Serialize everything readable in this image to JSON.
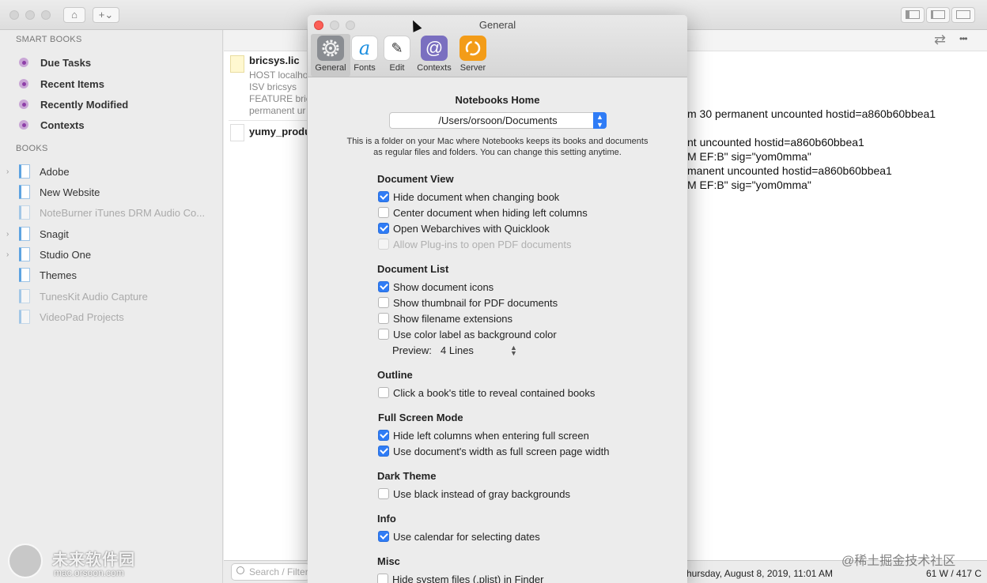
{
  "window": {
    "home_button": "⌂",
    "add_button": "+⌄"
  },
  "sidebar": {
    "smart_title": "SMART BOOKS",
    "smart_items": [
      {
        "label": "Due Tasks"
      },
      {
        "label": "Recent Items"
      },
      {
        "label": "Recently Modified"
      },
      {
        "label": "Contexts"
      }
    ],
    "books_title": "BOOKS",
    "books": [
      {
        "label": "Adobe",
        "disclosure": "›",
        "dim": false
      },
      {
        "label": "New Website",
        "disclosure": "",
        "dim": false
      },
      {
        "label": "NoteBurner iTunes DRM Audio Co...",
        "disclosure": "",
        "dim": true
      },
      {
        "label": "Snagit",
        "disclosure": "›",
        "dim": false
      },
      {
        "label": "Studio One",
        "disclosure": "›",
        "dim": false
      },
      {
        "label": "Themes",
        "disclosure": "",
        "dim": false
      },
      {
        "label": "TunesKit Audio Capture",
        "disclosure": "",
        "dim": true
      },
      {
        "label": "VideoPad Projects",
        "disclosure": "",
        "dim": true
      }
    ]
  },
  "doclist": {
    "docs": [
      {
        "title": "bricsys.lic",
        "preview": [
          "HOST localho",
          "ISV bricsys",
          "FEATURE bric",
          "permanent ur"
        ]
      },
      {
        "title": "yumy_produ",
        "preview": []
      }
    ],
    "search_placeholder": "Search / Filter"
  },
  "content": {
    "lines": [
      "m 30 permanent uncounted hostid=a860b60bbea1",
      "nt uncounted hostid=a860b60bbea1",
      "M EF:B\" sig=\"yom0mma\"",
      "manent uncounted hostid=a860b60bbea1",
      "M EF:B\" sig=\"yom0mma\""
    ],
    "swap_icon": "⇄",
    "more_icon": "•••"
  },
  "status": {
    "date": "hursday, August 8, 2019, 11:01 AM",
    "counts": "61 W / 417 C"
  },
  "prefs": {
    "title": "General",
    "tabs": [
      {
        "label": "General",
        "icon": "gear-icon"
      },
      {
        "label": "Fonts",
        "icon": "fonts-icon",
        "glyph": "a"
      },
      {
        "label": "Edit",
        "icon": "pencil-icon",
        "glyph": "✎"
      },
      {
        "label": "Contexts",
        "icon": "at-icon",
        "glyph": "@"
      },
      {
        "label": "Server",
        "icon": "sync-icon"
      }
    ],
    "home_heading": "Notebooks Home",
    "home_path": "/Users/orsoon/Documents",
    "help_line1": "This is a folder on your Mac where Notebooks keeps its books and documents",
    "help_line2": "as regular files and folders. You can change this setting anytime.",
    "groups": {
      "document_view": {
        "title": "Document View",
        "options": [
          {
            "label": "Hide document when changing book",
            "checked": true
          },
          {
            "label": "Center document when hiding left columns",
            "checked": false
          },
          {
            "label": "Open Webarchives with Quicklook",
            "checked": true
          },
          {
            "label": "Allow Plug-ins to open PDF documents",
            "checked": false,
            "disabled": true
          }
        ]
      },
      "document_list": {
        "title": "Document List",
        "options": [
          {
            "label": "Show document icons",
            "checked": true
          },
          {
            "label": "Show thumbnail for PDF documents",
            "checked": false
          },
          {
            "label": "Show filename extensions",
            "checked": false
          },
          {
            "label": "Use color label as background color",
            "checked": false
          }
        ],
        "preview_label": "Preview:",
        "preview_value": "4 Lines"
      },
      "outline": {
        "title": "Outline",
        "options": [
          {
            "label": "Click a book's title to reveal contained books",
            "checked": false
          }
        ]
      },
      "full_screen": {
        "title": "Full Screen Mode",
        "options": [
          {
            "label": "Hide left columns when entering full screen",
            "checked": true
          },
          {
            "label": "Use document's width as full screen page width",
            "checked": true
          }
        ]
      },
      "dark_theme": {
        "title": "Dark Theme",
        "options": [
          {
            "label": "Use black instead of gray backgrounds",
            "checked": false
          }
        ]
      },
      "info": {
        "title": "Info",
        "options": [
          {
            "label": "Use calendar for selecting dates",
            "checked": true
          }
        ]
      },
      "misc": {
        "title": "Misc",
        "options": [
          {
            "label": "Hide system files (.plist) in Finder",
            "checked": false
          }
        ]
      }
    }
  },
  "watermarks": {
    "left_cn": "未来软件园",
    "left_url": "mac.orsoon.com",
    "right": "@稀土掘金技术社区"
  },
  "colors": {
    "accent": "#2f7cf6",
    "smart_dot": "#8e3fa8",
    "book_icon": "#5da3e1",
    "close": "#fc5f57",
    "server_icon": "#f39c18",
    "contexts_icon": "#7a6fc0"
  }
}
